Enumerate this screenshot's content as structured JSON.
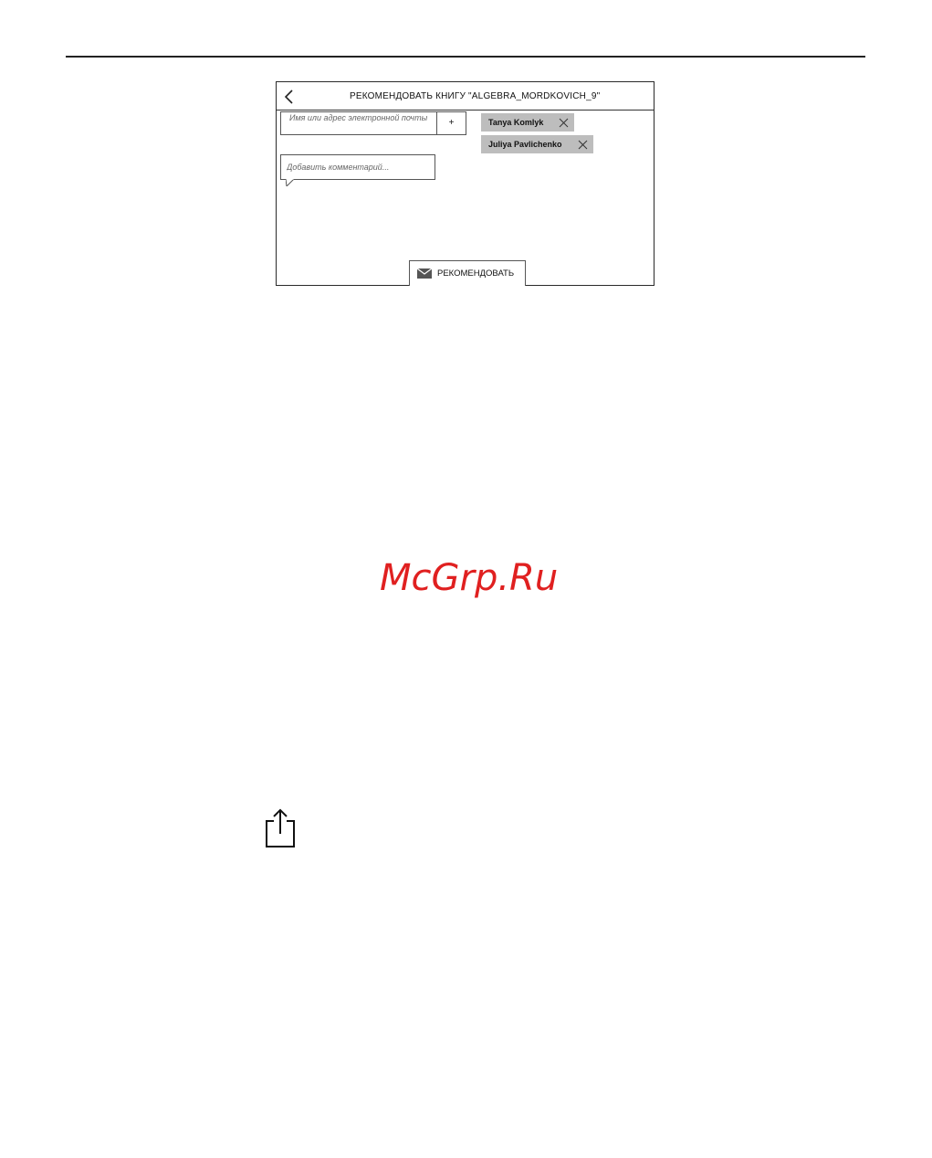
{
  "header": {
    "title": "РЕКОМЕНДОВАТЬ КНИГУ \"ALGEBRA_MORDKOVICH_9\""
  },
  "recipient": {
    "placeholder": "Имя или адрес электронной почты",
    "add_label": "+"
  },
  "chips": [
    {
      "name": "Tanya Komlyk"
    },
    {
      "name": "Juliya Pavlichenko"
    }
  ],
  "comment": {
    "placeholder": "Добавить комментарий..."
  },
  "recommend_button": {
    "label": "РЕКОМЕНДОВАТЬ",
    "icon": "mail-icon"
  },
  "icons": {
    "back": "chevron-left-icon",
    "chip_remove": "close-icon",
    "share": "share-icon"
  },
  "watermark": {
    "text": "McGrp.Ru",
    "color": "#e02020"
  },
  "colors": {
    "chip_background": "#bdbdbd",
    "border": "#555555"
  }
}
